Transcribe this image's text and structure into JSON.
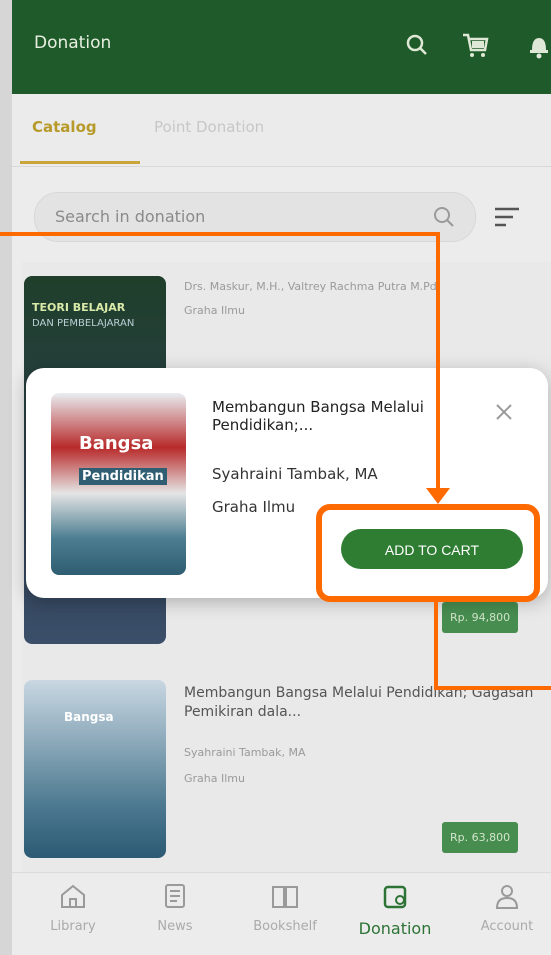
{
  "app_bar": {
    "title": "Donation"
  },
  "tabs": [
    {
      "label": "Catalog",
      "active": true
    },
    {
      "label": "Point Donation",
      "active": false
    }
  ],
  "search": {
    "placeholder": "Search in donation"
  },
  "books": [
    {
      "author": "Drs. Maskur, M.H., Valtrey Rachma Putra M.Pd.",
      "publisher": "Graha Ilmu",
      "cover_text": [
        "TEORI BELAJAR",
        "DAN PEMBELAJARAN"
      ],
      "price": "Rp. 94,800"
    },
    {
      "title": "Membangun Bangsa Melalui Pendidikan; Gagasan Pemikiran dala...",
      "author": "Syahraini Tambak, MA",
      "publisher": "Graha Ilmu",
      "price": "Rp. 63,800"
    }
  ],
  "dialog": {
    "title": "Membangun Bangsa Melalui Pendidikan;...",
    "author": "Syahraini Tambak, MA",
    "publisher": "Graha Ilmu",
    "button": "ADD TO CART",
    "cover_text": [
      "Bangsa",
      "Pendidikan"
    ]
  },
  "bottom_nav": [
    {
      "label": "Library",
      "icon": "home-icon",
      "active": false
    },
    {
      "label": "News",
      "icon": "news-icon",
      "active": false
    },
    {
      "label": "Bookshelf",
      "icon": "book-icon",
      "active": false
    },
    {
      "label": "Donation",
      "icon": "wallet-icon",
      "active": true
    },
    {
      "label": "Account",
      "icon": "account-icon",
      "active": false
    }
  ],
  "colors": {
    "primary": "#1f5a2a",
    "accent": "#2e7d32",
    "highlight": "#ff6a00",
    "tab_active": "#b79a2a"
  }
}
